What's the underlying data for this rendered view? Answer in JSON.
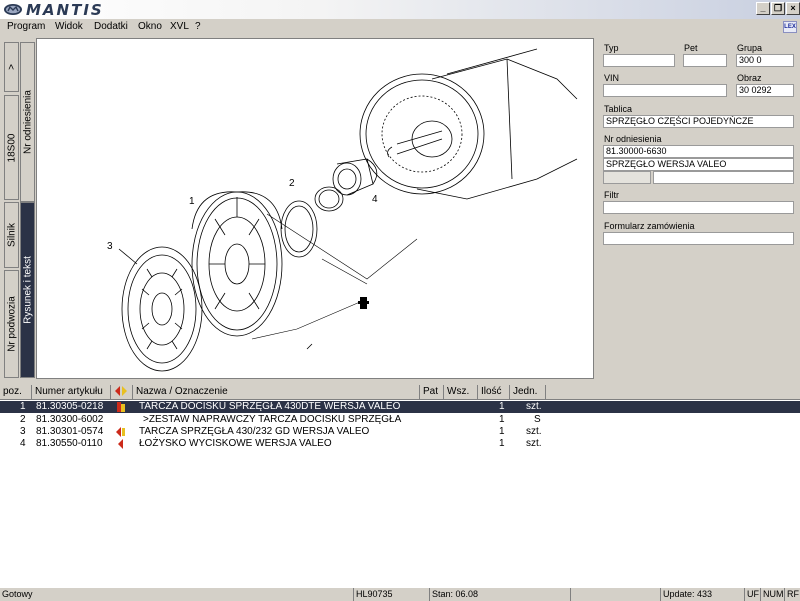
{
  "app": {
    "title": "MANTIS"
  },
  "menu": [
    "Program",
    "Widok",
    "Dodatki",
    "Okno",
    "XVL",
    "?"
  ],
  "window_buttons": [
    "_",
    "❐",
    "×"
  ],
  "badge": "LEX",
  "left_tabs": [
    "Nr odniesienia",
    "18S00",
    "Silnik",
    "Rysunek i tekst",
    "Nr podwozia",
    ">"
  ],
  "drawing": {
    "callouts": [
      "1",
      "2",
      "3",
      "4"
    ]
  },
  "fields": {
    "typ_label": "Typ",
    "typ_value": "",
    "pet_label": "Pet",
    "pet_value": "",
    "grupa_label": "Grupa",
    "grupa_value": "300 0",
    "vin_label": "VIN",
    "vin_value": "",
    "obraz_label": "Obraz",
    "obraz_value": "30 0292",
    "tablica_label": "Tablica",
    "tablica_value": "SPRZĘGŁO CZĘŚCI POJEDYŃCZE",
    "nr_label": "Nr odniesienia",
    "nr_value1": "81.30000-6630",
    "nr_value2": "SPRZĘGŁO WERSJA VALEO",
    "filtr_label": "Filtr",
    "filtr_value": "",
    "formularz_label": "Formularz zamówienia",
    "formularz_value": ""
  },
  "table": {
    "headers": [
      "poz.",
      "Numer artykułu",
      "",
      "Nazwa / Oznaczenie",
      "Pat",
      "Wsz.",
      "Ilość",
      "Jedn."
    ],
    "rows": [
      {
        "poz": "1",
        "num": "81.30305-0218",
        "name": "TARCZA DOCISKU SPRZĘGŁA 430DTE WERSJA VALEO",
        "qty": "1",
        "unit": "szt."
      },
      {
        "poz": "2",
        "num": "81.30300-6002",
        "name": ">ZESTAW NAPRAWCZY TARCZA DOCISKU SPRZĘGŁA",
        "qty": "1",
        "unit": "S"
      },
      {
        "poz": "3",
        "num": "81.30301-0574",
        "name": "TARCZA SPRZĘGŁA 430/232 GD WERSJA VALEO",
        "qty": "1",
        "unit": "szt."
      },
      {
        "poz": "4",
        "num": "81.30550-0110",
        "name": "ŁOŻYSKO WYCISKOWE WERSJA VALEO",
        "qty": "1",
        "unit": "szt."
      }
    ]
  },
  "status": {
    "ready": "Gotowy",
    "hl": "HL90735",
    "stan": "Stan: 06.08",
    "update": "Update: 433",
    "uf": "UF",
    "num": "NUM",
    "rf": "RF"
  },
  "colors": {
    "selection": "#2b3246",
    "window": "#d4d0c8",
    "marker_red": "#cc2a1a",
    "marker_yellow": "#e8c020"
  }
}
